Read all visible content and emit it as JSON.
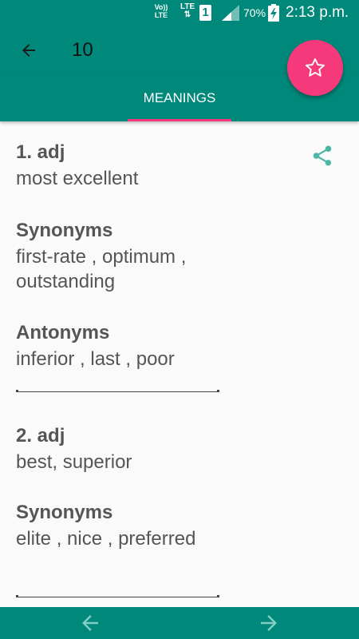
{
  "status_bar": {
    "volte": "Vo)) LTE",
    "lte": "LTE ⇅",
    "sim": "1",
    "battery": "70%",
    "time": "2:13 p.m."
  },
  "toolbar": {
    "title": "10"
  },
  "tabs": [
    {
      "label": "MEANINGS",
      "selected": true
    }
  ],
  "meanings": [
    {
      "heading": "1. adj",
      "definition": "most excellent",
      "synonyms_label": "Synonyms",
      "synonyms_line1": "first-rate , optimum ,",
      "synonyms_line2": "outstanding",
      "antonyms_label": "Antonyms",
      "antonyms": "inferior , last , poor"
    },
    {
      "heading": "2. adj",
      "definition": "best, superior",
      "synonyms_label": "Synonyms",
      "synonyms": "elite , nice , preferred"
    }
  ],
  "colors": {
    "primary": "#00897b",
    "accent": "#f5397b",
    "text": "#555555"
  },
  "icons": {
    "back": "arrow-left-icon",
    "favorite": "star-icon",
    "share": "share-icon",
    "prev": "arrow-left-icon",
    "next": "arrow-right-icon"
  }
}
